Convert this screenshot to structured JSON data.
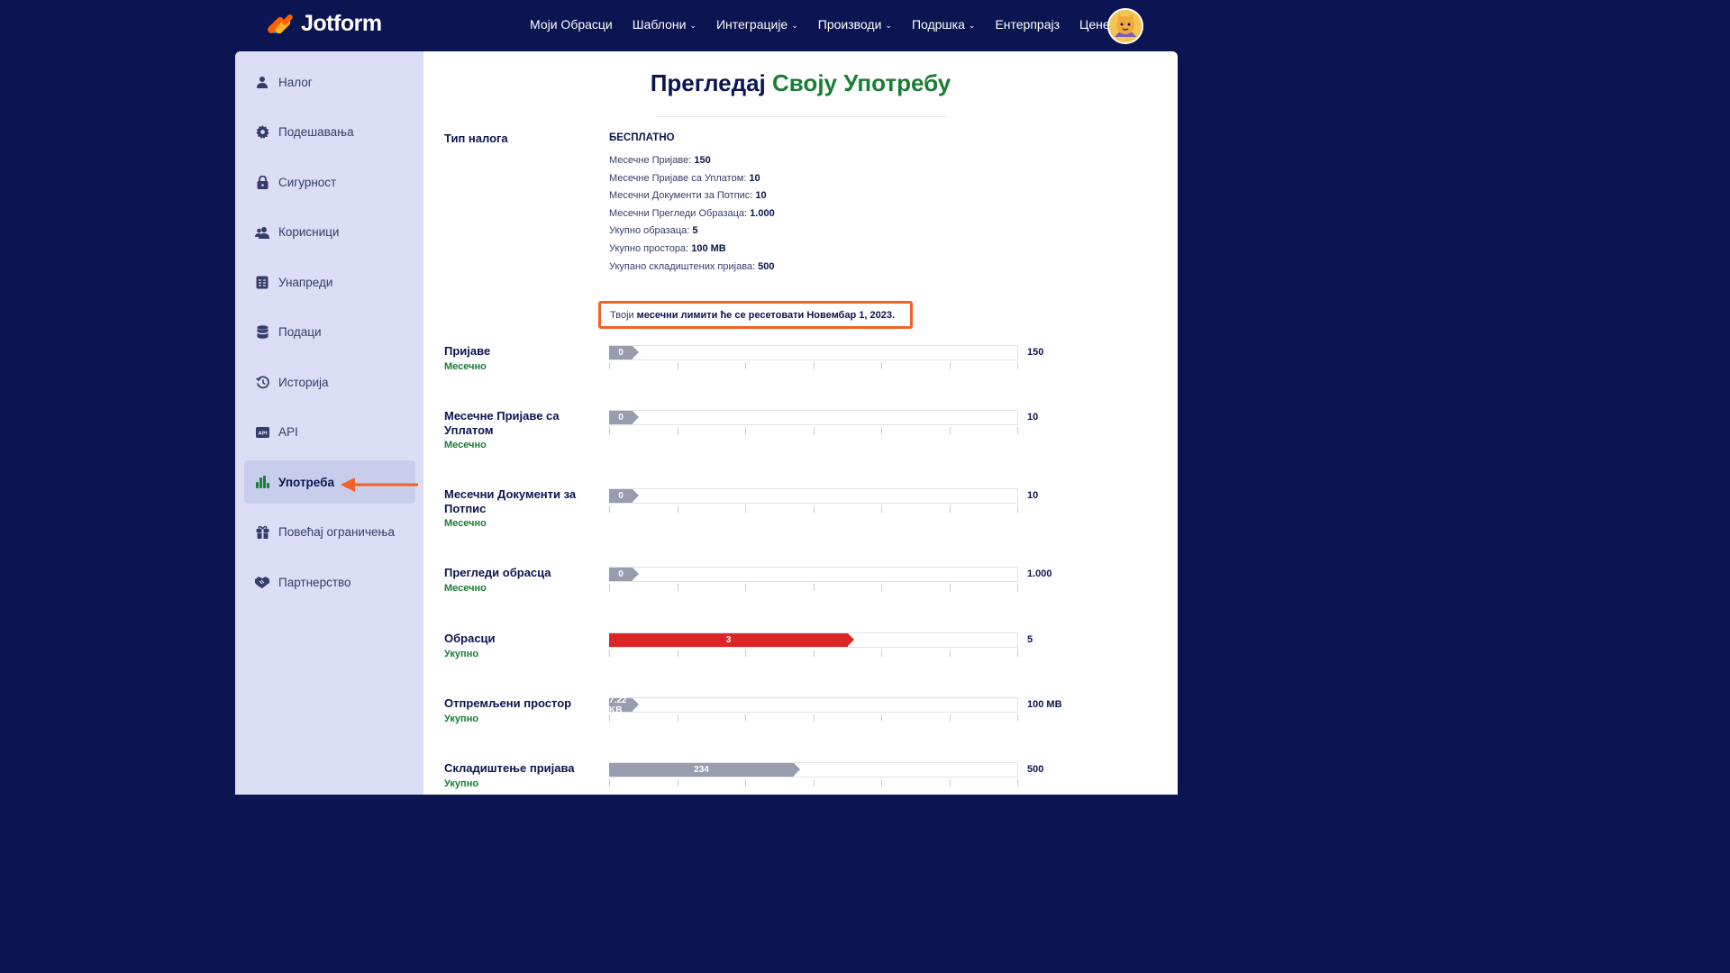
{
  "brand": {
    "name": "Jotform"
  },
  "nav": {
    "items": [
      {
        "label": "Моји Обрасци",
        "dropdown": false
      },
      {
        "label": "Шаблони",
        "dropdown": true
      },
      {
        "label": "Интеграције",
        "dropdown": true
      },
      {
        "label": "Производи",
        "dropdown": true
      },
      {
        "label": "Подршка",
        "dropdown": true
      },
      {
        "label": "Ентерпрајз",
        "dropdown": false
      },
      {
        "label": "Цене",
        "dropdown": false
      }
    ]
  },
  "sidebar": {
    "items": [
      {
        "label": "Налог",
        "icon": "user-icon"
      },
      {
        "label": "Подешавања",
        "icon": "gear-icon"
      },
      {
        "label": "Сигурност",
        "icon": "lock-icon"
      },
      {
        "label": "Корисници",
        "icon": "users-icon"
      },
      {
        "label": "Унапреди",
        "icon": "upgrade-icon"
      },
      {
        "label": "Подаци",
        "icon": "database-icon"
      },
      {
        "label": "Историја",
        "icon": "history-icon"
      },
      {
        "label": "API",
        "icon": "api-icon"
      },
      {
        "label": "Употреба",
        "icon": "bar-chart-icon",
        "active": true
      },
      {
        "label": "Повећај ограничења",
        "icon": "gift-icon"
      },
      {
        "label": "Партнерство",
        "icon": "handshake-icon"
      }
    ]
  },
  "main": {
    "title_part1": "Прегледај",
    "title_part2": "Своју Употребу",
    "account_type_label": "Тип налога",
    "account_type_value": "БЕСПЛАТНО",
    "limits": [
      {
        "label": "Месечне Пријаве:",
        "value": "150"
      },
      {
        "label": "Месечне Пријаве са Уплатом:",
        "value": "10"
      },
      {
        "label": "Месечни Документи за Потпис:",
        "value": "10"
      },
      {
        "label": "Месечни Прегледи Образаца:",
        "value": "1.000"
      },
      {
        "label": "Укупно образаца:",
        "value": "5"
      },
      {
        "label": "Укупно простора:",
        "value": "100 MB"
      },
      {
        "label": "Укупано складиштених пријава:",
        "value": "500"
      }
    ],
    "reset_prefix": "Твоји",
    "reset_bold": "месечни лимити ће се ресетовати Новембар 1, 2023.",
    "usage_rows": [
      {
        "label": "Пријаве",
        "period": "Месечно",
        "used": "0",
        "max": "150",
        "fraction": 0,
        "color": "#979dae"
      },
      {
        "label": "Месечне Пријаве са Уплатом",
        "period": "Месечно",
        "used": "0",
        "max": "10",
        "fraction": 0,
        "color": "#979dae"
      },
      {
        "label": "Месечни Документи за Потпис",
        "period": "Месечно",
        "used": "0",
        "max": "10",
        "fraction": 0,
        "color": "#979dae"
      },
      {
        "label": "Прегледи обрасца",
        "period": "Месечно",
        "used": "0",
        "max": "1.000",
        "fraction": 0,
        "color": "#979dae"
      },
      {
        "label": "Обрасци",
        "period": "Укупно",
        "used": "3",
        "max": "5",
        "fraction": 0.6,
        "color": "#dc2626"
      },
      {
        "label": "Отпремљени простор",
        "period": "Укупно",
        "used": "7.22 KB",
        "max": "100 MB",
        "fraction": 0.0001,
        "color": "#979dae"
      },
      {
        "label": "Складиштење пријава",
        "period": "Укупно",
        "used": "234",
        "max": "500",
        "fraction": 0.468,
        "color": "#979dae"
      }
    ]
  },
  "colors": {
    "background": "#0a1551",
    "accent_green": "#1a7d34",
    "highlight_orange": "#ef6327"
  }
}
